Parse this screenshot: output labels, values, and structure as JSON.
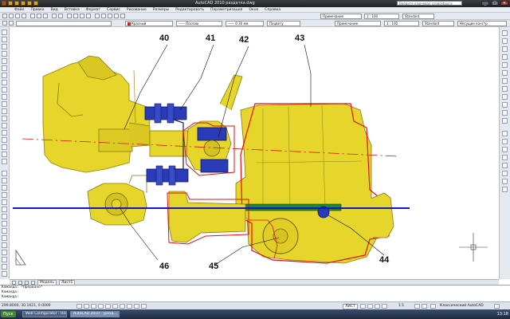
{
  "titlebar": {
    "title": "AutoCAD 2010   раздатка.dwg",
    "search_placeholder": "Введите ключевое слово/фразу"
  },
  "menubar": {
    "items": [
      "Файл",
      "Правка",
      "Вид",
      "Вставка",
      "Формат",
      "Сервис",
      "Рисование",
      "Размеры",
      "Редактировать",
      "Параметризация",
      "Окно",
      "Справка"
    ]
  },
  "toolbar_properties": {
    "color_value": "Красный",
    "color_hex": "#d81e1e",
    "linetype_value": "—— Послою",
    "lineweight_value": "—— 0.30 мм",
    "plotstyle_value": "Поцвету",
    "annotation_scale": "1 : 100",
    "text_style": "Standard",
    "layer_value": "Несущие констр",
    "note_combo_1": "Примечание",
    "note_combo_2": "Примечание"
  },
  "drawing": {
    "callouts": [
      "40",
      "41",
      "42",
      "43",
      "44",
      "45",
      "46"
    ],
    "colors": {
      "part_fill": "#e6d52a",
      "outline": "#e01010",
      "blue_parts": "#2a3bb8",
      "axis_line": "#1414c8",
      "green_bar": "#1f8a2a"
    }
  },
  "tabs": {
    "model": "Модель",
    "sheet1": "Лист1"
  },
  "command_line": {
    "line1": "Команда:  *Прервано*",
    "line2": "Команда:",
    "line3": "Команда:"
  },
  "statusbar": {
    "coords": "299.8000, 30.1621, 0.0000",
    "model_label": "ЛИСТ",
    "scale": "1:1",
    "workspace": "Классический AutoCAD"
  },
  "taskbar": {
    "start": "Пуск",
    "tasks": [
      "Web Configurator - Hesi...",
      "AutoCAD 2010 - [разд..."
    ],
    "time": "13:18"
  }
}
